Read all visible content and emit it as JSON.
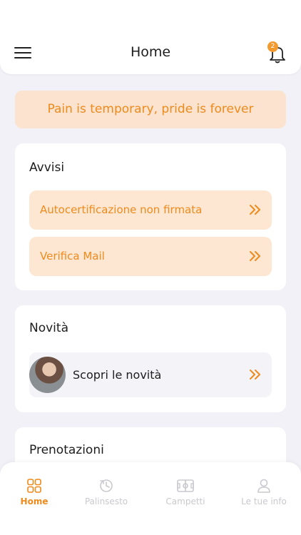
{
  "header": {
    "title": "Home",
    "notification_count": "2"
  },
  "motto": "Pain is temporary, pride is forever",
  "alerts": {
    "title": "Avvisi",
    "items": [
      {
        "label": "Autocertificazione non firmata"
      },
      {
        "label": "Verifica Mail"
      }
    ]
  },
  "news": {
    "title": "Novità",
    "item_label": "Scopri le novità"
  },
  "bookings": {
    "title": "Prenotazioni"
  },
  "tabbar": {
    "tabs": [
      {
        "label": "Home",
        "icon": "grid-icon",
        "active": true
      },
      {
        "label": "Palinsesto",
        "icon": "schedule-icon",
        "active": false
      },
      {
        "label": "Campetti",
        "icon": "field-icon",
        "active": false
      },
      {
        "label": "Le tue info",
        "icon": "user-icon",
        "active": false
      }
    ]
  },
  "colors": {
    "accent": "#ef8a1c",
    "accent_bg": "#fde7d2",
    "background": "#f1f1f7"
  }
}
